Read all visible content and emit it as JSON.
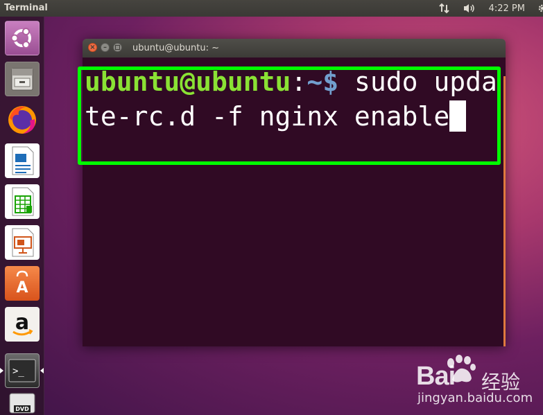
{
  "top_panel": {
    "app_title": "Terminal",
    "clock": "4:22 PM"
  },
  "launcher": {
    "items": [
      {
        "name": "ubuntu-dash"
      },
      {
        "name": "files"
      },
      {
        "name": "firefox"
      },
      {
        "name": "libreoffice-writer"
      },
      {
        "name": "libreoffice-calc"
      },
      {
        "name": "libreoffice-impress"
      },
      {
        "name": "ubuntu-software"
      },
      {
        "name": "amazon"
      },
      {
        "name": "terminal"
      },
      {
        "name": "dvd"
      }
    ],
    "amazon_letter": "a",
    "dvd_label": "DVD",
    "terminal_prompt_glyph": ">_"
  },
  "terminal": {
    "window_title": "ubuntu@ubuntu: ~",
    "prompt_user": "ubuntu@ubuntu",
    "prompt_colon": ":",
    "prompt_path": "~$",
    "command": " sudo update-rc.d -f nginx enable"
  },
  "watermark": {
    "brand": "Bai",
    "brand_cn": "经验",
    "url": "jingyan.baidu.com"
  },
  "colors": {
    "highlight": "#00ff00",
    "terminal_bg": "#300a24",
    "prompt_user": "#8ae234",
    "prompt_path": "#729fcf"
  }
}
